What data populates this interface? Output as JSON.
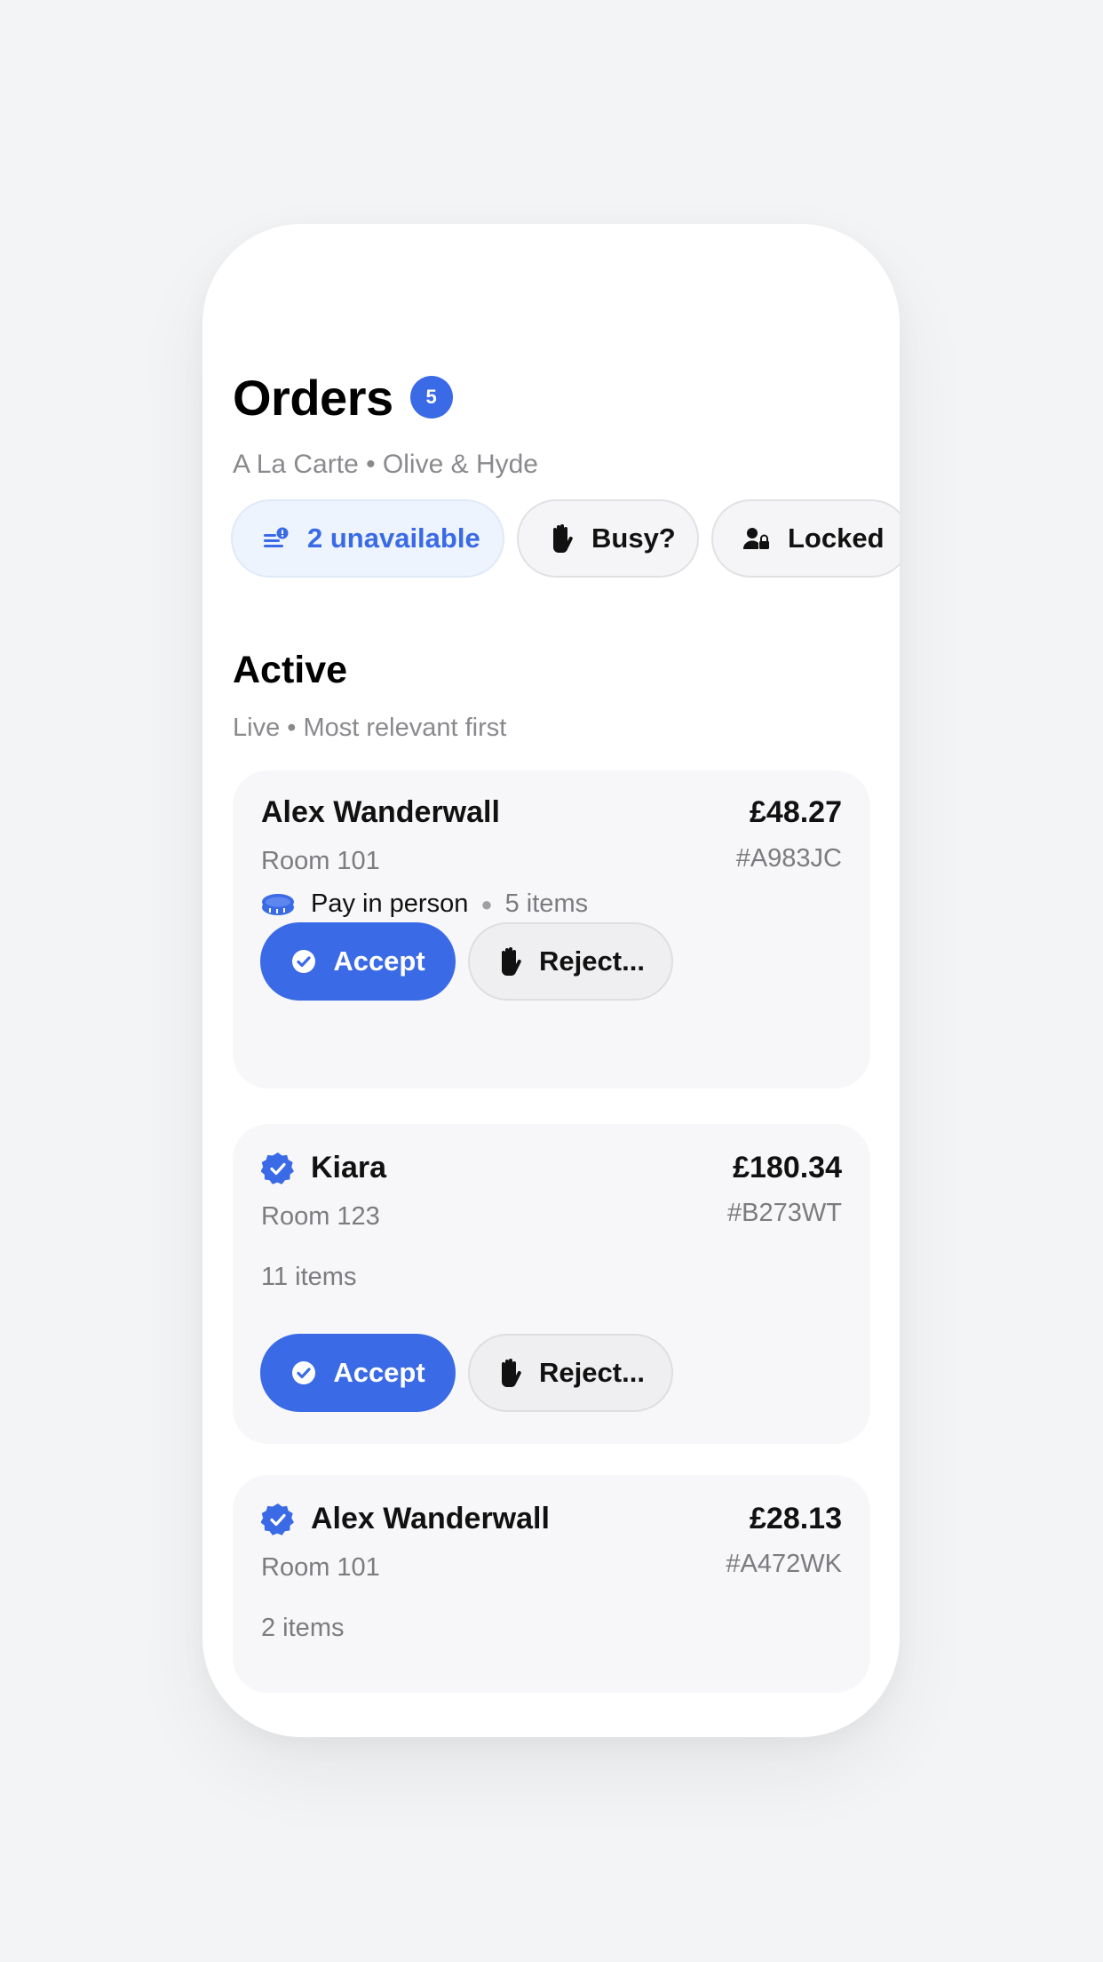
{
  "header": {
    "title": "Orders",
    "count": "5",
    "subtitle": "A La Carte • Olive & Hyde"
  },
  "chips": [
    {
      "label": "2 unavailable",
      "icon": "list-alert-icon"
    },
    {
      "label": "Busy?",
      "icon": "hand-icon"
    },
    {
      "label": "Locked",
      "icon": "user-lock-icon"
    }
  ],
  "section": {
    "title": "Active",
    "subtitle": "Live • Most relevant first"
  },
  "orders": [
    {
      "name": "Alex Wanderwall",
      "verified": false,
      "room": "Room 101",
      "price": "£48.27",
      "ref": "#A983JC",
      "payment": "Pay in person",
      "items": "5 items",
      "accept_label": "Accept",
      "reject_label": "Reject..."
    },
    {
      "name": "Kiara",
      "verified": true,
      "room": "Room 123",
      "price": "£180.34",
      "ref": "#B273WT",
      "items": "11 items",
      "accept_label": "Accept",
      "reject_label": "Reject..."
    },
    {
      "name": "Alex Wanderwall",
      "verified": true,
      "room": "Room 101",
      "price": "£28.13",
      "ref": "#A472WK",
      "items": "2 items"
    }
  ],
  "colors": {
    "accent": "#3a6ae6",
    "background": "#f2f4f5",
    "card": "#f7f7f9"
  }
}
